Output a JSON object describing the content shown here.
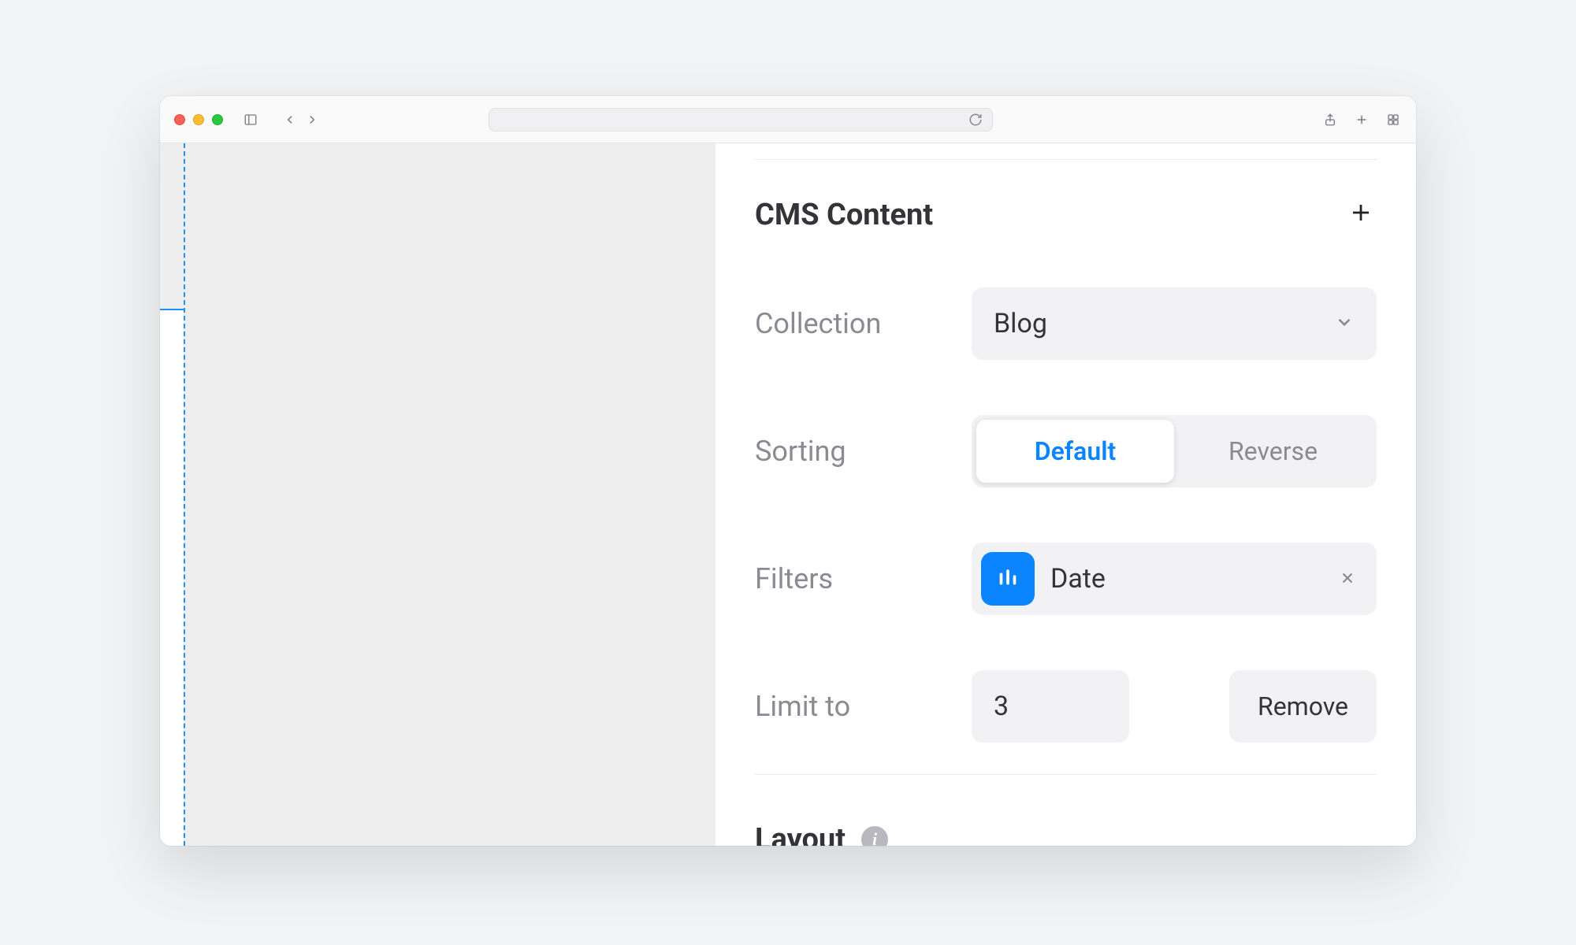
{
  "panel": {
    "cms_title": "CMS Content",
    "collection_label": "Collection",
    "collection_value": "Blog",
    "sorting_label": "Sorting",
    "sorting_default": "Default",
    "sorting_reverse": "Reverse",
    "filters_label": "Filters",
    "filter_chip": "Date",
    "limit_label": "Limit to",
    "limit_value": "3",
    "remove_label": "Remove",
    "layout_title": "Layout"
  }
}
